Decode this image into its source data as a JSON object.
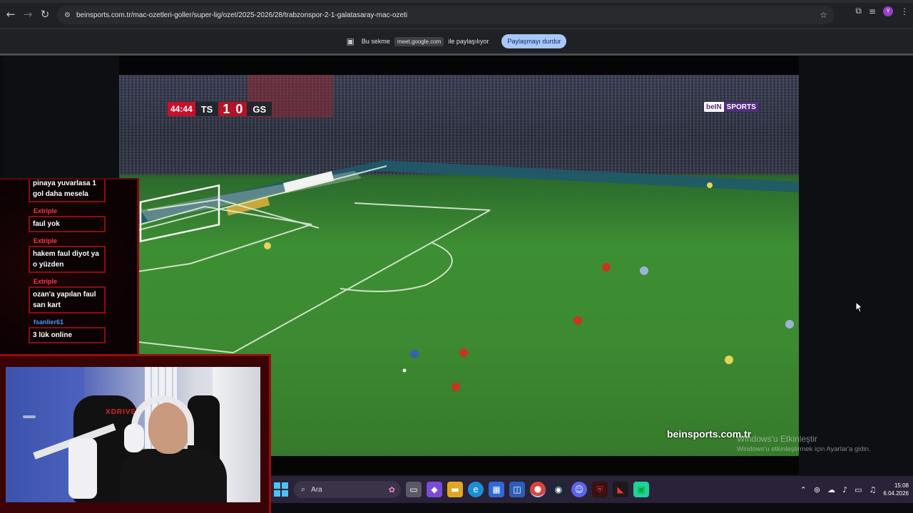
{
  "browser": {
    "url": "beinsports.com.tr/mac-ozetleri-goller/super-lig/ozet/2025-2026/28/trabzonspor-2-1-galatasaray-mac-ozeti",
    "profile_initial": "Y"
  },
  "sharebar": {
    "prefix": "Bu sekme",
    "domain": "meet.google.com",
    "suffix": "ile paylaşılıyor",
    "stop_button": "Paylaşmayı durdur"
  },
  "video": {
    "clock": "44:44",
    "home_team": "TS",
    "home_score": "1",
    "away_score": "0",
    "away_team": "GS",
    "channel_logo_a": "beIN",
    "channel_logo_b": "SPORTS",
    "site_watermark": "beinsports.com.tr"
  },
  "windows_watermark": {
    "title": "Windows'u Etkinleştir",
    "subtitle": "Windows'u etkinleştirmek için Ayarlar'a gidin."
  },
  "chat": {
    "messages": [
      {
        "user": "",
        "text": "pinaya yuvarlasa 1 gol daha mesela"
      },
      {
        "user": "Extriple",
        "text": "faul yok"
      },
      {
        "user": "Extriple",
        "text": "hakem faul diyot ya o yüzden"
      },
      {
        "user": "Extriple",
        "text": "ozan'a yapılan faul sarı kart"
      },
      {
        "user": "fsanlier61",
        "text": "3 lük online"
      }
    ]
  },
  "webcam": {
    "chair_brand": "XDRIVE"
  },
  "taskbar": {
    "search_placeholder": "Ara",
    "time": "15:08",
    "date": "6.04.2026"
  },
  "colors": {
    "accent_red": "#c8102e",
    "bein_purple": "#522d80",
    "chat_user_red": "#ff3a44",
    "chat_user_blue": "#3e9bff",
    "share_button": "#a8c7fa"
  }
}
